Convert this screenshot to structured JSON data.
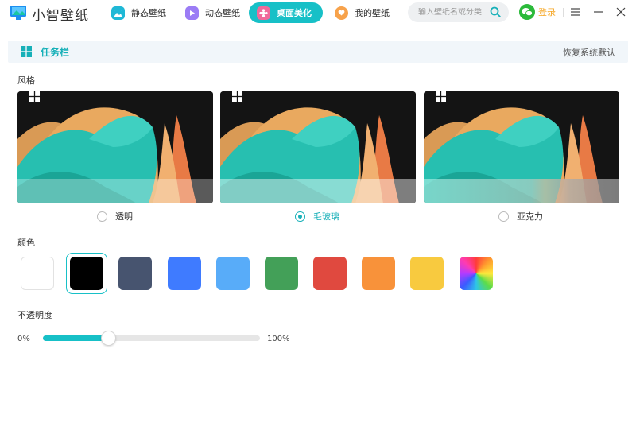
{
  "app": {
    "title": "小智壁纸",
    "brand_color": "#17c0c7"
  },
  "nav": {
    "tabs": [
      {
        "label": "静态壁纸",
        "icon": "static-wallpaper-icon",
        "icon_color": "#1fb8d6",
        "active": false
      },
      {
        "label": "动态壁纸",
        "icon": "dynamic-wallpaper-icon",
        "icon_color": "#9b7cf5",
        "active": false
      },
      {
        "label": "桌面美化",
        "icon": "desktop-beautify-icon",
        "icon_color": "#f06a9a",
        "active": true
      },
      {
        "label": "我的壁纸",
        "icon": "my-wallpaper-icon",
        "icon_color": "#f7a24b",
        "active": false
      }
    ]
  },
  "search": {
    "placeholder": "输入壁纸名或分类",
    "value": ""
  },
  "login": {
    "label": "登录"
  },
  "section": {
    "title": "任务栏",
    "reset_label": "恢复系统默认"
  },
  "style": {
    "label": "风格",
    "options": [
      {
        "label": "透明",
        "checked": false
      },
      {
        "label": "毛玻璃",
        "checked": true
      },
      {
        "label": "亚克力",
        "checked": false
      }
    ]
  },
  "color": {
    "label": "颜色",
    "swatches": [
      "#ffffff",
      "#000000",
      "#47546f",
      "#3f7bff",
      "#58acf9",
      "#43a058",
      "#e0493f",
      "#f8923a",
      "#f8ca3f",
      "rainbow"
    ],
    "selected_index": 1
  },
  "opacity": {
    "label": "不透明度",
    "min_label": "0%",
    "max_label": "100%",
    "value_percent": 30
  }
}
